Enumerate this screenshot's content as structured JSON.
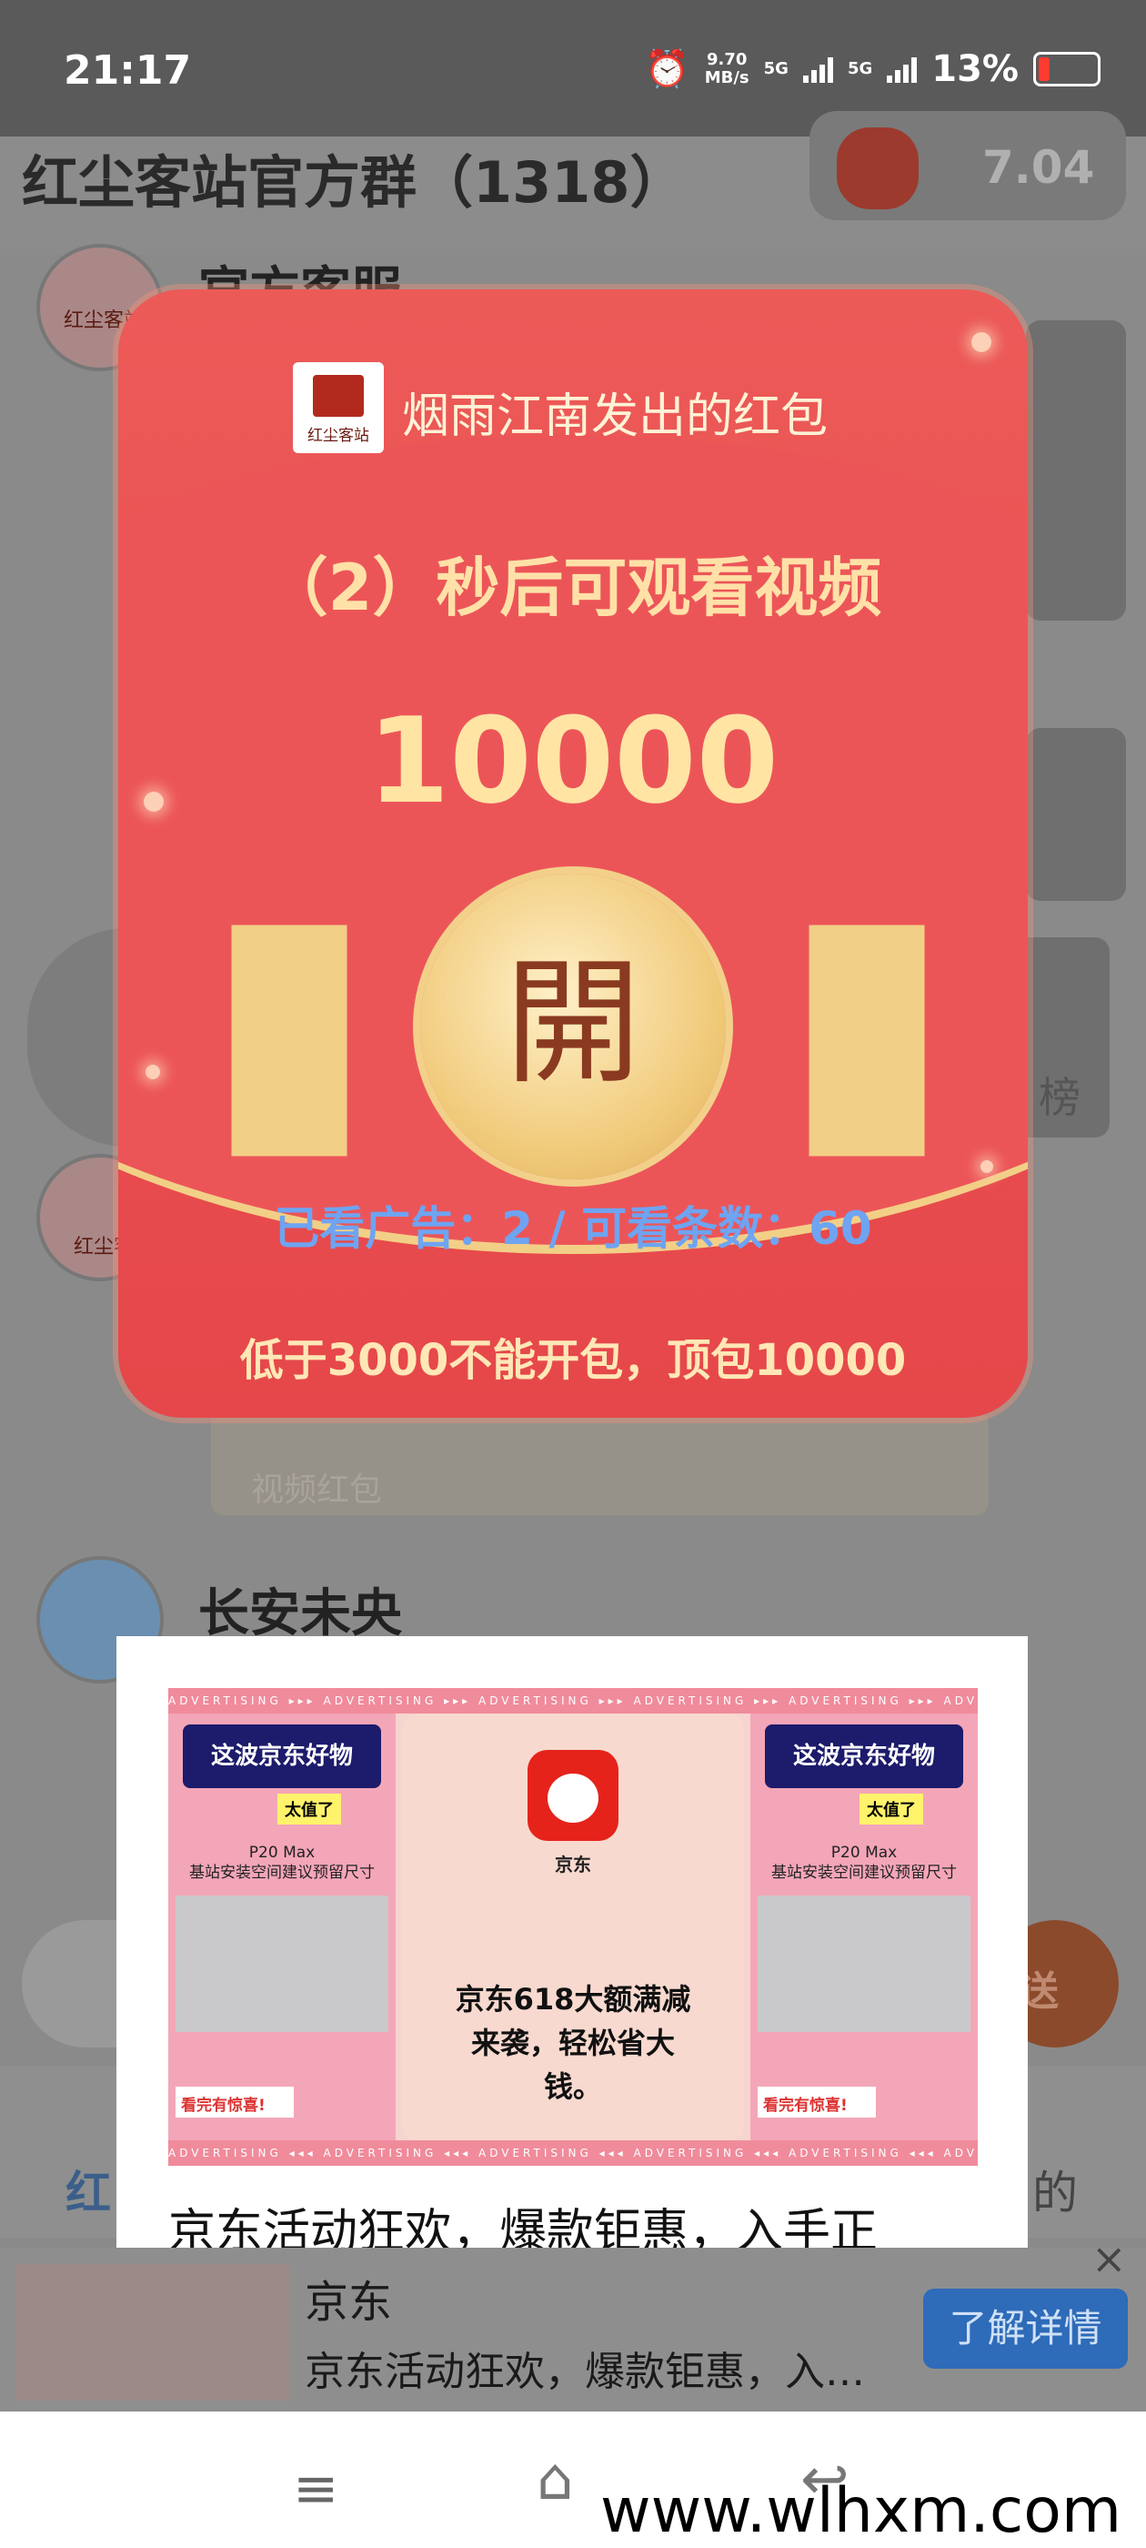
{
  "status_bar": {
    "time": "21:17",
    "net_speed_value": "9.70",
    "net_speed_unit": "MB/s",
    "sim1": "5G",
    "sim2": "5G",
    "battery": "13%",
    "icons": [
      "alarm-icon",
      "signal-icon",
      "battery-icon"
    ]
  },
  "chat": {
    "title": "红尘客站官方群（1318）",
    "balance": "7.04",
    "members": [
      {
        "name": "官方客服",
        "avatar_text": "红尘客站"
      },
      {
        "name": "",
        "avatar_text": "红尘客"
      },
      {
        "name": "长安未央"
      }
    ],
    "bubble_text": "视频红包",
    "send_label": "送",
    "tabs": [
      {
        "label": "红"
      },
      {
        "label": "的"
      }
    ],
    "side_label": "榜"
  },
  "red_packet": {
    "logo_text": "红尘客站",
    "from_text": "烟雨江南发出的红包",
    "countdown_text": "（2）秒后可观看视频",
    "amount": "10000",
    "open_label": "開",
    "watched_text": "已看广告：2  /  可看条数：60",
    "rule_text": "低于3000不能开包，顶包10000",
    "colors": {
      "body": "#e84d50",
      "gold": "#f2cf86",
      "amount": "#ffe4a4",
      "stats": "#6ea4f2"
    }
  },
  "ad": {
    "brand": "京东",
    "headline_left": "这波京东好物",
    "headline_tag": "太值了",
    "product": "P20 Max",
    "product_sub": "基站安装空间建议预留尺寸",
    "footer_tag": "看完有惊喜!",
    "quote": "京东618大额满减来袭，轻松省大钱。",
    "strip_text": "ADVERTISING",
    "description": "京东活动狂欢，爆款钜惠，入手正"
  },
  "banner": {
    "title": "京东",
    "description": "京东活动狂欢，爆款钜惠，入…",
    "cta": "了解详情",
    "close": "×"
  },
  "nav": {
    "menu": "≡",
    "home": "⌂",
    "back": "↩"
  },
  "watermark": "www.wlhxm.com"
}
